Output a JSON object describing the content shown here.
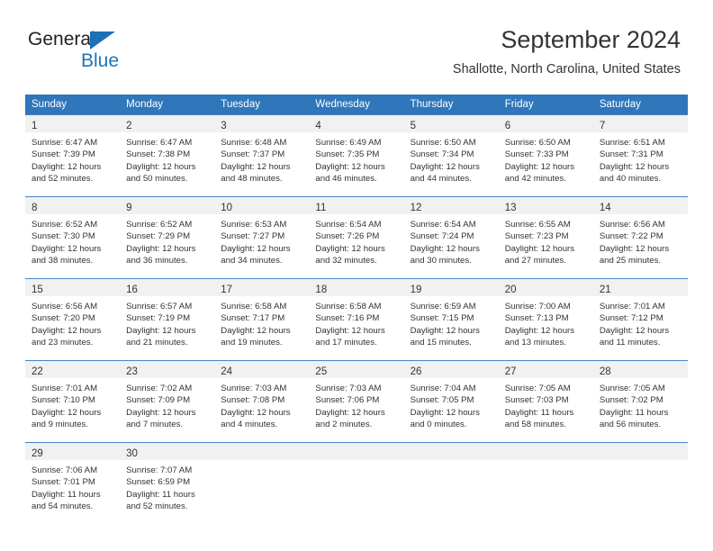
{
  "brand": {
    "name_top": "General",
    "name_bottom": "Blue",
    "accent_color": "#1b75bb"
  },
  "header": {
    "title": "September 2024",
    "subtitle": "Shallotte, North Carolina, United States"
  },
  "calendar": {
    "header_color": "#2f76bb",
    "weekday_headers": [
      "Sunday",
      "Monday",
      "Tuesday",
      "Wednesday",
      "Thursday",
      "Friday",
      "Saturday"
    ],
    "labels": {
      "sunrise": "Sunrise:",
      "sunset": "Sunset:",
      "daylight": "Daylight:"
    },
    "weeks": [
      [
        {
          "day": "1",
          "sunrise": "Sunrise: 6:47 AM",
          "sunset": "Sunset: 7:39 PM",
          "daylight_line1": "Daylight: 12 hours",
          "daylight_line2": "and 52 minutes."
        },
        {
          "day": "2",
          "sunrise": "Sunrise: 6:47 AM",
          "sunset": "Sunset: 7:38 PM",
          "daylight_line1": "Daylight: 12 hours",
          "daylight_line2": "and 50 minutes."
        },
        {
          "day": "3",
          "sunrise": "Sunrise: 6:48 AM",
          "sunset": "Sunset: 7:37 PM",
          "daylight_line1": "Daylight: 12 hours",
          "daylight_line2": "and 48 minutes."
        },
        {
          "day": "4",
          "sunrise": "Sunrise: 6:49 AM",
          "sunset": "Sunset: 7:35 PM",
          "daylight_line1": "Daylight: 12 hours",
          "daylight_line2": "and 46 minutes."
        },
        {
          "day": "5",
          "sunrise": "Sunrise: 6:50 AM",
          "sunset": "Sunset: 7:34 PM",
          "daylight_line1": "Daylight: 12 hours",
          "daylight_line2": "and 44 minutes."
        },
        {
          "day": "6",
          "sunrise": "Sunrise: 6:50 AM",
          "sunset": "Sunset: 7:33 PM",
          "daylight_line1": "Daylight: 12 hours",
          "daylight_line2": "and 42 minutes."
        },
        {
          "day": "7",
          "sunrise": "Sunrise: 6:51 AM",
          "sunset": "Sunset: 7:31 PM",
          "daylight_line1": "Daylight: 12 hours",
          "daylight_line2": "and 40 minutes."
        }
      ],
      [
        {
          "day": "8",
          "sunrise": "Sunrise: 6:52 AM",
          "sunset": "Sunset: 7:30 PM",
          "daylight_line1": "Daylight: 12 hours",
          "daylight_line2": "and 38 minutes."
        },
        {
          "day": "9",
          "sunrise": "Sunrise: 6:52 AM",
          "sunset": "Sunset: 7:29 PM",
          "daylight_line1": "Daylight: 12 hours",
          "daylight_line2": "and 36 minutes."
        },
        {
          "day": "10",
          "sunrise": "Sunrise: 6:53 AM",
          "sunset": "Sunset: 7:27 PM",
          "daylight_line1": "Daylight: 12 hours",
          "daylight_line2": "and 34 minutes."
        },
        {
          "day": "11",
          "sunrise": "Sunrise: 6:54 AM",
          "sunset": "Sunset: 7:26 PM",
          "daylight_line1": "Daylight: 12 hours",
          "daylight_line2": "and 32 minutes."
        },
        {
          "day": "12",
          "sunrise": "Sunrise: 6:54 AM",
          "sunset": "Sunset: 7:24 PM",
          "daylight_line1": "Daylight: 12 hours",
          "daylight_line2": "and 30 minutes."
        },
        {
          "day": "13",
          "sunrise": "Sunrise: 6:55 AM",
          "sunset": "Sunset: 7:23 PM",
          "daylight_line1": "Daylight: 12 hours",
          "daylight_line2": "and 27 minutes."
        },
        {
          "day": "14",
          "sunrise": "Sunrise: 6:56 AM",
          "sunset": "Sunset: 7:22 PM",
          "daylight_line1": "Daylight: 12 hours",
          "daylight_line2": "and 25 minutes."
        }
      ],
      [
        {
          "day": "15",
          "sunrise": "Sunrise: 6:56 AM",
          "sunset": "Sunset: 7:20 PM",
          "daylight_line1": "Daylight: 12 hours",
          "daylight_line2": "and 23 minutes."
        },
        {
          "day": "16",
          "sunrise": "Sunrise: 6:57 AM",
          "sunset": "Sunset: 7:19 PM",
          "daylight_line1": "Daylight: 12 hours",
          "daylight_line2": "and 21 minutes."
        },
        {
          "day": "17",
          "sunrise": "Sunrise: 6:58 AM",
          "sunset": "Sunset: 7:17 PM",
          "daylight_line1": "Daylight: 12 hours",
          "daylight_line2": "and 19 minutes."
        },
        {
          "day": "18",
          "sunrise": "Sunrise: 6:58 AM",
          "sunset": "Sunset: 7:16 PM",
          "daylight_line1": "Daylight: 12 hours",
          "daylight_line2": "and 17 minutes."
        },
        {
          "day": "19",
          "sunrise": "Sunrise: 6:59 AM",
          "sunset": "Sunset: 7:15 PM",
          "daylight_line1": "Daylight: 12 hours",
          "daylight_line2": "and 15 minutes."
        },
        {
          "day": "20",
          "sunrise": "Sunrise: 7:00 AM",
          "sunset": "Sunset: 7:13 PM",
          "daylight_line1": "Daylight: 12 hours",
          "daylight_line2": "and 13 minutes."
        },
        {
          "day": "21",
          "sunrise": "Sunrise: 7:01 AM",
          "sunset": "Sunset: 7:12 PM",
          "daylight_line1": "Daylight: 12 hours",
          "daylight_line2": "and 11 minutes."
        }
      ],
      [
        {
          "day": "22",
          "sunrise": "Sunrise: 7:01 AM",
          "sunset": "Sunset: 7:10 PM",
          "daylight_line1": "Daylight: 12 hours",
          "daylight_line2": "and 9 minutes."
        },
        {
          "day": "23",
          "sunrise": "Sunrise: 7:02 AM",
          "sunset": "Sunset: 7:09 PM",
          "daylight_line1": "Daylight: 12 hours",
          "daylight_line2": "and 7 minutes."
        },
        {
          "day": "24",
          "sunrise": "Sunrise: 7:03 AM",
          "sunset": "Sunset: 7:08 PM",
          "daylight_line1": "Daylight: 12 hours",
          "daylight_line2": "and 4 minutes."
        },
        {
          "day": "25",
          "sunrise": "Sunrise: 7:03 AM",
          "sunset": "Sunset: 7:06 PM",
          "daylight_line1": "Daylight: 12 hours",
          "daylight_line2": "and 2 minutes."
        },
        {
          "day": "26",
          "sunrise": "Sunrise: 7:04 AM",
          "sunset": "Sunset: 7:05 PM",
          "daylight_line1": "Daylight: 12 hours",
          "daylight_line2": "and 0 minutes."
        },
        {
          "day": "27",
          "sunrise": "Sunrise: 7:05 AM",
          "sunset": "Sunset: 7:03 PM",
          "daylight_line1": "Daylight: 11 hours",
          "daylight_line2": "and 58 minutes."
        },
        {
          "day": "28",
          "sunrise": "Sunrise: 7:05 AM",
          "sunset": "Sunset: 7:02 PM",
          "daylight_line1": "Daylight: 11 hours",
          "daylight_line2": "and 56 minutes."
        }
      ],
      [
        {
          "day": "29",
          "sunrise": "Sunrise: 7:06 AM",
          "sunset": "Sunset: 7:01 PM",
          "daylight_line1": "Daylight: 11 hours",
          "daylight_line2": "and 54 minutes."
        },
        {
          "day": "30",
          "sunrise": "Sunrise: 7:07 AM",
          "sunset": "Sunset: 6:59 PM",
          "daylight_line1": "Daylight: 11 hours",
          "daylight_line2": "and 52 minutes."
        },
        {
          "day": "",
          "sunrise": "",
          "sunset": "",
          "daylight_line1": "",
          "daylight_line2": ""
        },
        {
          "day": "",
          "sunrise": "",
          "sunset": "",
          "daylight_line1": "",
          "daylight_line2": ""
        },
        {
          "day": "",
          "sunrise": "",
          "sunset": "",
          "daylight_line1": "",
          "daylight_line2": ""
        },
        {
          "day": "",
          "sunrise": "",
          "sunset": "",
          "daylight_line1": "",
          "daylight_line2": ""
        },
        {
          "day": "",
          "sunrise": "",
          "sunset": "",
          "daylight_line1": "",
          "daylight_line2": ""
        }
      ]
    ]
  }
}
